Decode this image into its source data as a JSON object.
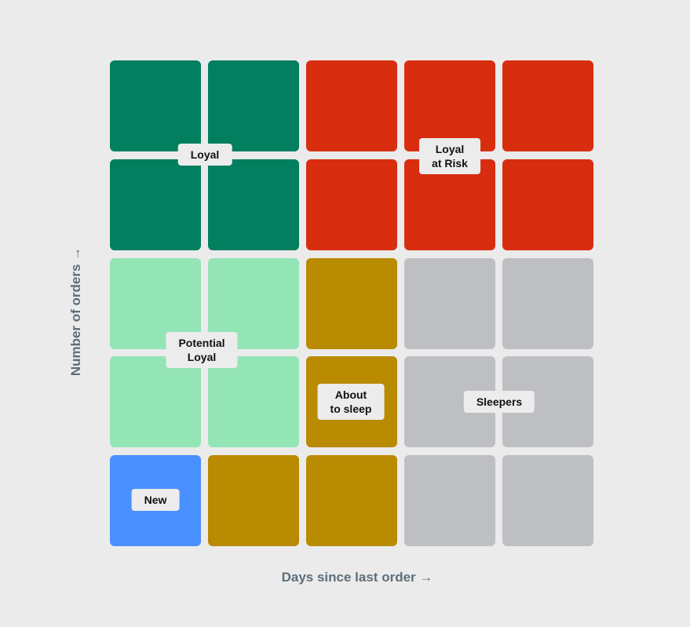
{
  "colors": {
    "loyal": "#017f5f",
    "at_risk": "#d92d10",
    "potential": "#93e5b6",
    "sleep": "#b98b00",
    "sleepers": "#bdbfc3",
    "new": "#4a8fff"
  },
  "grid": [
    [
      "loyal",
      "loyal",
      "at_risk",
      "at_risk",
      "at_risk"
    ],
    [
      "loyal",
      "loyal",
      "at_risk",
      "at_risk",
      "at_risk"
    ],
    [
      "potential",
      "potential",
      "sleep",
      "sleepers",
      "sleepers"
    ],
    [
      "potential",
      "potential",
      "sleep",
      "sleepers",
      "sleepers"
    ],
    [
      "new",
      "sleep",
      "sleep",
      "sleepers",
      "sleepers"
    ]
  ],
  "labels": {
    "loyal": "Loyal",
    "at_risk": "Loyal\nat Risk",
    "potential": "Potential\nLoyal",
    "sleep": "About\nto sleep",
    "sleepers": "Sleepers",
    "new": "New"
  },
  "axes": {
    "x": "Days since last order →",
    "y": "Number of orders →"
  }
}
